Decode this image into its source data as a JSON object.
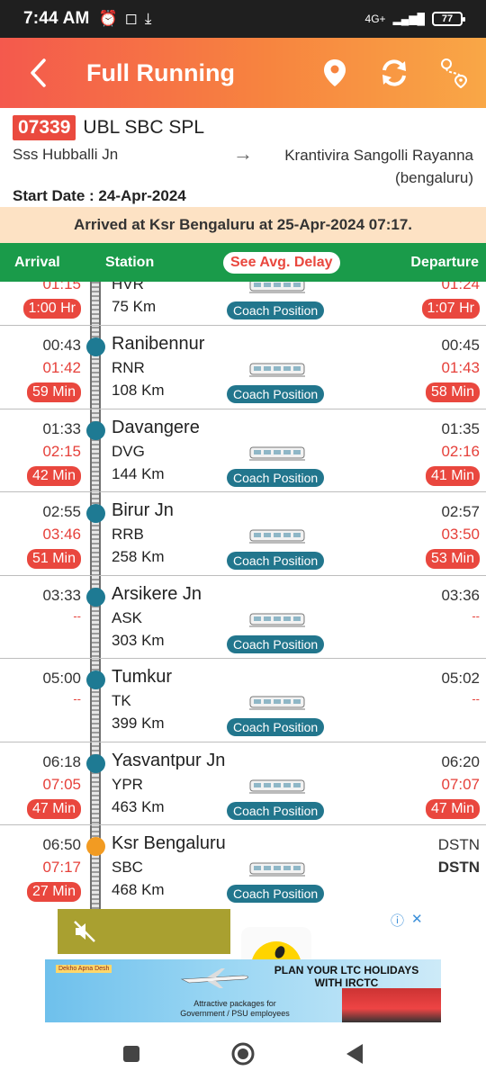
{
  "status_bar": {
    "time": "7:44 AM",
    "battery": "77",
    "network": "4G+"
  },
  "header": {
    "title": "Full Running"
  },
  "train": {
    "number": "07339",
    "name": "UBL SBC SPL",
    "from": "Sss Hubballi Jn",
    "to": "Krantivira Sangolli Rayanna (bengaluru)",
    "arrow": "→",
    "start_date": "Start Date : 24-Apr-2024"
  },
  "arrived_banner": "Arrived at Ksr Bengaluru at 25-Apr-2024 07:17.",
  "columns": {
    "arrival": "Arrival",
    "station": "Station",
    "avg_delay": "See Avg. Delay",
    "departure": "Departure"
  },
  "coach_label": "Coach Position",
  "stations": [
    {
      "name": "HVR",
      "code": "",
      "dist": "75 Km",
      "arr": "",
      "arr_actual": "01:15",
      "arr_delay": "1:00 Hr",
      "dep": "",
      "dep_actual": "01:24",
      "dep_delay": "1:07 Hr"
    },
    {
      "name": "Ranibennur",
      "code": "RNR",
      "dist": "108 Km",
      "arr": "00:43",
      "arr_actual": "01:42",
      "arr_delay": "59 Min",
      "dep": "00:45",
      "dep_actual": "01:43",
      "dep_delay": "58 Min"
    },
    {
      "name": "Davangere",
      "code": "DVG",
      "dist": "144 Km",
      "arr": "01:33",
      "arr_actual": "02:15",
      "arr_delay": "42 Min",
      "dep": "01:35",
      "dep_actual": "02:16",
      "dep_delay": "41 Min"
    },
    {
      "name": "Birur Jn",
      "code": "RRB",
      "dist": "258 Km",
      "arr": "02:55",
      "arr_actual": "03:46",
      "arr_delay": "51 Min",
      "dep": "02:57",
      "dep_actual": "03:50",
      "dep_delay": "53 Min"
    },
    {
      "name": "Arsikere Jn",
      "code": "ASK",
      "dist": "303 Km",
      "arr": "03:33",
      "arr_actual": "--",
      "arr_delay": "",
      "dep": "03:36",
      "dep_actual": "--",
      "dep_delay": ""
    },
    {
      "name": "Tumkur",
      "code": "TK",
      "dist": "399 Km",
      "arr": "05:00",
      "arr_actual": "--",
      "arr_delay": "",
      "dep": "05:02",
      "dep_actual": "--",
      "dep_delay": ""
    },
    {
      "name": "Yasvantpur Jn",
      "code": "YPR",
      "dist": "463 Km",
      "arr": "06:18",
      "arr_actual": "07:05",
      "arr_delay": "47 Min",
      "dep": "06:20",
      "dep_actual": "07:07",
      "dep_delay": "47 Min"
    },
    {
      "name": "Ksr Bengaluru",
      "code": "SBC",
      "dist": "468 Km",
      "arr": "06:50",
      "arr_actual": "07:17",
      "arr_delay": "27 Min",
      "dep": "DSTN",
      "dep_actual": "DSTN",
      "dep_delay": ""
    }
  ],
  "ad": {
    "headline": "PLAN YOUR LTC HOLIDAYS WITH IRCTC",
    "sub": "Attractive packages for Government / PSU employees",
    "brand": "Dekho Apna Desh"
  },
  "colors": {
    "accent_red": "#e9473e",
    "header_green": "#1a9b4a",
    "dot_blue": "#1e7a93",
    "dot_current": "#f29b22"
  },
  "icons": [
    "back-arrow-icon",
    "location-pin-icon",
    "refresh-icon",
    "route-map-icon",
    "mute-icon",
    "ad-info-icon",
    "ad-close-icon"
  ]
}
